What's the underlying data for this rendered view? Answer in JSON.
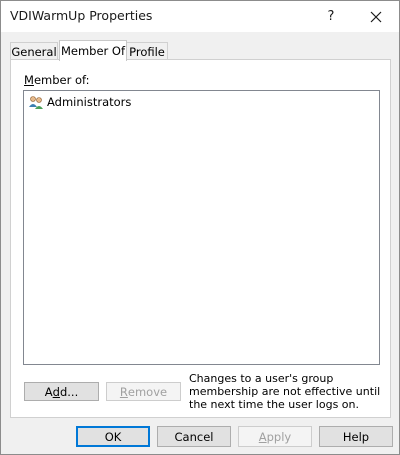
{
  "window": {
    "title": "VDIWarmUp Properties",
    "help_glyph": "?",
    "close_icon": "close-icon"
  },
  "tabs": [
    {
      "label": "General",
      "selected": false
    },
    {
      "label": "Member Of",
      "selected": true
    },
    {
      "label": "Profile",
      "selected": false
    }
  ],
  "member_of": {
    "label_prefix": "M",
    "label_rest": "ember of:",
    "items": [
      {
        "name": "Administrators",
        "icon": "group-icon"
      }
    ]
  },
  "buttons": {
    "add": {
      "prefix": "A",
      "underlined": "d",
      "suffix": "d..."
    },
    "remove": {
      "underlined": "R",
      "suffix": "emove",
      "enabled": false
    }
  },
  "note": "Changes to a user's group membership are not effective until the next time the user logs on.",
  "footer": {
    "ok": "OK",
    "cancel": "Cancel",
    "apply_underlined": "A",
    "apply_rest": "pply",
    "help": "Help"
  },
  "colors": {
    "focus_border": "#0078d7",
    "dialog_bg": "#f0f0f0",
    "panel_bg": "#ffffff"
  }
}
